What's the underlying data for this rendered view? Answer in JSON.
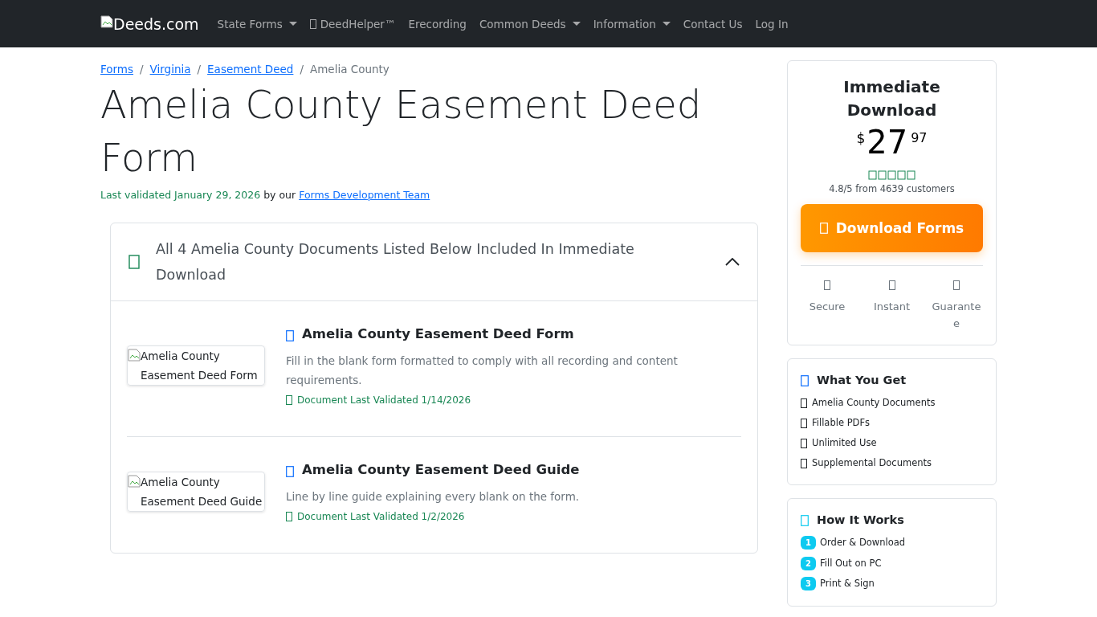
{
  "navbar": {
    "logo": "Deeds.com",
    "items": [
      {
        "label": "State Forms",
        "dropdown": true,
        "icon": false
      },
      {
        "label": "DeedHelper™",
        "dropdown": false,
        "icon": true
      },
      {
        "label": "Erecording",
        "dropdown": false,
        "icon": false
      },
      {
        "label": "Common Deeds",
        "dropdown": true,
        "icon": false
      },
      {
        "label": "Information",
        "dropdown": true,
        "icon": false
      },
      {
        "label": "Contact Us",
        "dropdown": false,
        "icon": false
      },
      {
        "label": "Log In",
        "dropdown": false,
        "icon": false
      }
    ]
  },
  "breadcrumb": [
    {
      "label": "Forms",
      "link": true
    },
    {
      "separator": "/",
      "label": "Virginia",
      "link": true
    },
    {
      "separator": "/",
      "label": "Easement Deed",
      "link": true
    },
    {
      "separator": "/",
      "label": "Amelia County",
      "link": false
    }
  ],
  "title": "Amelia County Easement Deed Form",
  "validated": {
    "prefix": "Last validated January 29, 2026",
    "by": "by our",
    "link": "Forms Development Team"
  },
  "accordion": {
    "heading": "All 4 Amelia County Documents Listed Below Included In Immediate Download",
    "expanded": true,
    "documents": [
      {
        "image_alt": "Amelia County Easement Deed Form",
        "title": "Amelia County Easement Deed Form",
        "description": "Fill in the blank form formatted to comply with all recording and content requirements.",
        "validated": "Document Last Validated 1/14/2026"
      },
      {
        "image_alt": "Amelia County Easement Deed Guide",
        "title": "Amelia County Easement Deed Guide",
        "description": "Line by line guide explaining every blank on the form.",
        "validated": "Document Last Validated 1/2/2026"
      }
    ]
  },
  "purchase": {
    "title": "Immediate Download",
    "currency": "$",
    "dollars": "27",
    "cents": "97",
    "rating": "4.8/5 from 4639 customers",
    "button": "Download Forms",
    "features": [
      "Secure",
      "Instant",
      "Guarantee"
    ]
  },
  "what_you_get": {
    "title": "What You Get",
    "items": [
      "Amelia County Documents",
      "Fillable PDFs",
      "Unlimited Use",
      "Supplemental Documents"
    ]
  },
  "how_it_works": {
    "title": "How It Works",
    "steps": [
      {
        "number": "1",
        "label": "Order & Download"
      },
      {
        "number": "2",
        "label": "Fill Out on PC"
      },
      {
        "number": "3",
        "label": "Print & Sign"
      }
    ]
  }
}
